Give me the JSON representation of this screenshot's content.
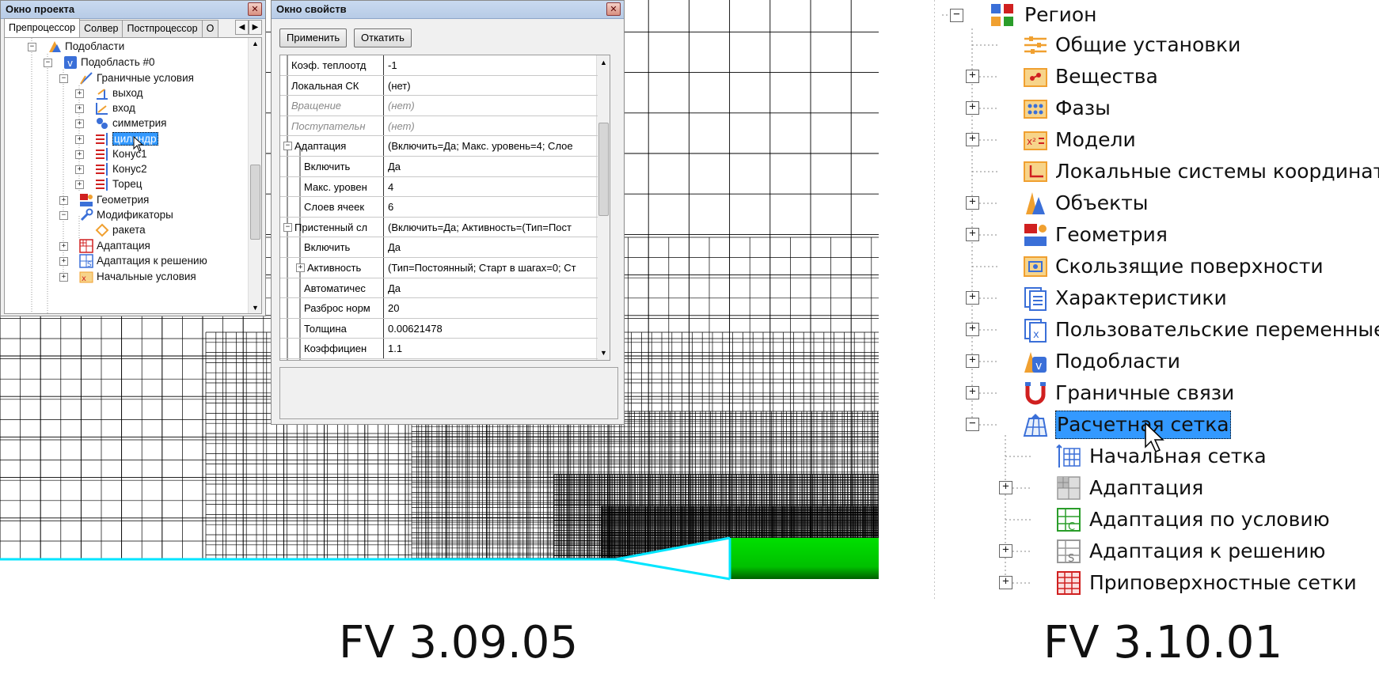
{
  "left_panel": {
    "project_window": {
      "title": "Окно проекта",
      "close": "✕",
      "tabs": [
        "Препроцессор",
        "Солвер",
        "Постпроцессор",
        "О"
      ],
      "tab_left": "◀",
      "tab_right": "▶",
      "tree": [
        {
          "label": "Подобласти"
        },
        {
          "label": "Подобласть #0"
        },
        {
          "label": "Граничные условия"
        },
        {
          "label": "выход"
        },
        {
          "label": "вход"
        },
        {
          "label": "симметрия"
        },
        {
          "label": "цилиндр"
        },
        {
          "label": "Конус1"
        },
        {
          "label": "Конус2"
        },
        {
          "label": "Торец"
        },
        {
          "label": "Геометрия"
        },
        {
          "label": "Модификаторы"
        },
        {
          "label": "ракета"
        },
        {
          "label": "Адаптация"
        },
        {
          "label": "Адаптация к решению"
        },
        {
          "label": "Начальные условия"
        }
      ],
      "selected": "цилиндр"
    },
    "props_window": {
      "title": "Окно свойств",
      "close": "✕",
      "apply": "Применить",
      "rollback": "Откатить",
      "rows": [
        {
          "name": "Коэф. теплоотд",
          "value": "-1"
        },
        {
          "name": "Локальная СК",
          "value": "(нет)"
        },
        {
          "name": "Вращение",
          "value": "(нет)"
        },
        {
          "name": "Поступательн",
          "value": "(нет)"
        },
        {
          "name": "Адаптация",
          "value": "(Включить=Да; Макс. уровень=4; Слое"
        },
        {
          "name": "Включить",
          "value": "Да"
        },
        {
          "name": "Макс. уровен",
          "value": "4"
        },
        {
          "name": "Слоев ячеек",
          "value": "6"
        },
        {
          "name": "Пристенный сл",
          "value": "(Включить=Да; Активность=(Тип=Пост"
        },
        {
          "name": "Включить",
          "value": "Да"
        },
        {
          "name": "Активность",
          "value": "(Тип=Постоянный; Старт в шагах=0; Ст"
        },
        {
          "name": "Автоматичес",
          "value": "Да"
        },
        {
          "name": "Разброс норм",
          "value": "20"
        },
        {
          "name": "Толщина",
          "value": "0.00621478"
        },
        {
          "name": "Коэффициен",
          "value": "1.1"
        }
      ]
    },
    "version": "FV 3.09.05"
  },
  "right_panel": {
    "tree": [
      {
        "label": "Регион"
      },
      {
        "label": "Общие установки"
      },
      {
        "label": "Вещества"
      },
      {
        "label": "Фазы"
      },
      {
        "label": "Модели"
      },
      {
        "label": "Локальные системы координат"
      },
      {
        "label": "Объекты"
      },
      {
        "label": "Геометрия"
      },
      {
        "label": "Скользящие поверхности"
      },
      {
        "label": "Характеристики"
      },
      {
        "label": "Пользовательские переменные"
      },
      {
        "label": "Подобласти"
      },
      {
        "label": "Граничные связи"
      },
      {
        "label": "Расчетная сетка"
      },
      {
        "label": "Начальная сетка"
      },
      {
        "label": "Адаптация"
      },
      {
        "label": "Адаптация по условию"
      },
      {
        "label": "Адаптация к решению"
      },
      {
        "label": "Приповерхностные сетки"
      }
    ],
    "selected": "Расчетная сетка",
    "version": "FV 3.10.01"
  },
  "colors": {
    "accent": "#3399ff",
    "mesh_line": "#000000",
    "symmetry": "#00e5ff",
    "body": "#00cc00"
  }
}
